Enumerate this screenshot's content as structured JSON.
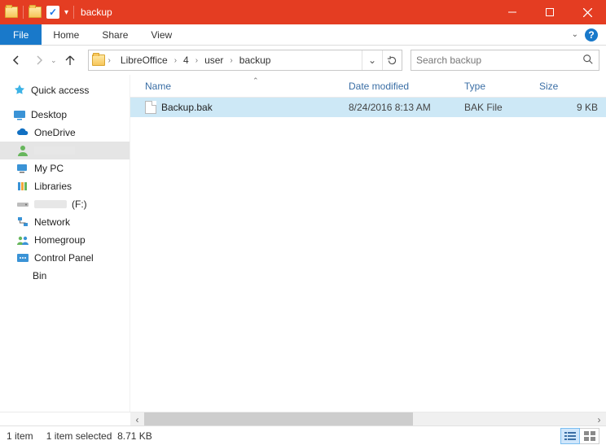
{
  "window": {
    "title": "backup"
  },
  "ribbon": {
    "file": "File",
    "tabs": [
      "Home",
      "Share",
      "View"
    ]
  },
  "address": {
    "crumbs": [
      "LibreOffice",
      "4",
      "user",
      "backup"
    ]
  },
  "search": {
    "placeholder": "Search backup"
  },
  "sidebar": {
    "quick_access": "Quick access",
    "desktop": "Desktop",
    "items": [
      {
        "label": "OneDrive"
      },
      {
        "label": ""
      },
      {
        "label": "My PC"
      },
      {
        "label": "Libraries"
      },
      {
        "label_suffix": "(F:)"
      },
      {
        "label": "Network"
      },
      {
        "label": "Homegroup"
      },
      {
        "label": "Control Panel"
      },
      {
        "label": "Bin"
      }
    ]
  },
  "columns": {
    "name": "Name",
    "date": "Date modified",
    "type": "Type",
    "size": "Size"
  },
  "files": [
    {
      "name": "Backup.bak",
      "date": "8/24/2016 8:13 AM",
      "type": "BAK File",
      "size": "9 KB"
    }
  ],
  "status": {
    "count": "1 item",
    "selected": "1 item selected",
    "size": "8.71 KB"
  }
}
